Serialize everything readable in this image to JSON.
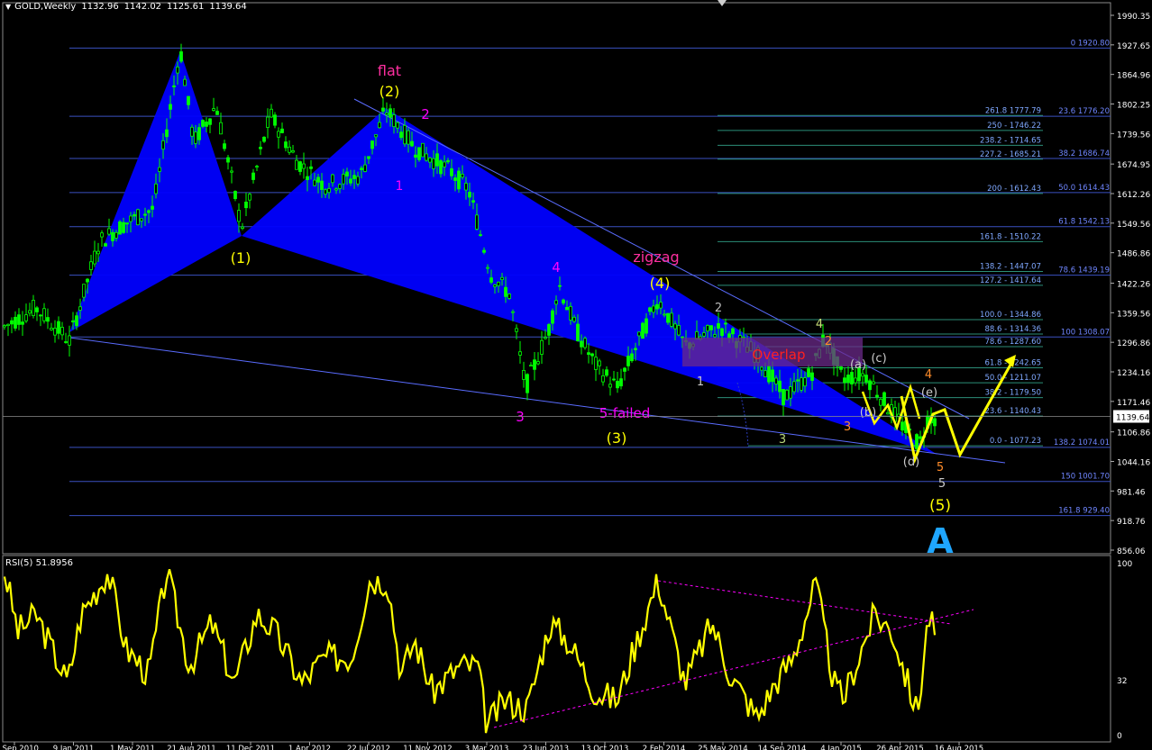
{
  "symbol": {
    "name": "GOLD,Weekly",
    "open": "1132.96",
    "high": "1142.02",
    "low": "1125.61",
    "close": "1139.64"
  },
  "price_axis": {
    "ticks": [
      "1990.35",
      "1927.65",
      "1864.96",
      "1802.25",
      "1739.56",
      "1674.95",
      "1612.26",
      "1549.56",
      "1486.86",
      "1422.26",
      "1359.56",
      "1296.86",
      "1234.16",
      "1171.46",
      "1106.86",
      "1044.16",
      "981.46",
      "918.76",
      "856.06"
    ],
    "current": "1139.64"
  },
  "rsi": {
    "label": "RSI(5) 51.8956",
    "ticks": [
      "100",
      "32",
      "0"
    ]
  },
  "date_axis": [
    "10 Sep 2010",
    "9 Jan 2011",
    "1 May 2011",
    "21 Aug 2011",
    "11 Dec 2011",
    "1 Apr 2012",
    "22 Jul 2012",
    "11 Nov 2012",
    "3 Mar 2013",
    "23 Jun 2013",
    "13 Oct 2013",
    "2 Feb 2014",
    "25 May 2014",
    "14 Sep 2014",
    "4 Jan 2015",
    "26 Apr 2015",
    "16 Aug 2015"
  ],
  "fib_right": [
    {
      "text": "0 1920.80",
      "price": 1920.8
    },
    {
      "text": "23.6 1776.20",
      "price": 1776.2
    },
    {
      "text": "38.2 1686.74",
      "price": 1686.74
    },
    {
      "text": "50.0 1614.43",
      "price": 1614.43
    },
    {
      "text": "61.8 1542.13",
      "price": 1542.13
    },
    {
      "text": "78.6 1439.19",
      "price": 1439.19
    },
    {
      "text": "100 1308.07",
      "price": 1308.07
    },
    {
      "text": "138.2 1074.01",
      "price": 1074.01
    },
    {
      "text": "150 1001.70",
      "price": 1001.7
    },
    {
      "text": "161.8 929.40",
      "price": 929.4
    }
  ],
  "fib_mid": [
    {
      "text": "261.8 1777.79",
      "price": 1777.79
    },
    {
      "text": "250 - 1746.22",
      "price": 1746.22
    },
    {
      "text": "238.2 - 1714.65",
      "price": 1714.65
    },
    {
      "text": "227.2 - 1685.21",
      "price": 1685.21
    },
    {
      "text": "200 - 1612.43",
      "price": 1612.43
    },
    {
      "text": "161.8 - 1510.22",
      "price": 1510.22
    },
    {
      "text": "138.2 - 1447.07",
      "price": 1447.07
    },
    {
      "text": "127.2 - 1417.64",
      "price": 1417.64
    },
    {
      "text": "100.0 - 1344.86",
      "price": 1344.86
    },
    {
      "text": "88.6 - 1314.36",
      "price": 1314.36
    },
    {
      "text": "78.6 - 1287.60",
      "price": 1287.6
    },
    {
      "text": "61.8 - 1242.65",
      "price": 1242.65
    },
    {
      "text": "50.0 - 1211.07",
      "price": 1211.07
    },
    {
      "text": "38.2 - 1179.50",
      "price": 1179.5
    },
    {
      "text": "23.6 - 1140.43",
      "price": 1140.43
    },
    {
      "text": "0.0 - 1077.23",
      "price": 1077.23
    }
  ],
  "annotations": {
    "flat": "flat",
    "w2": "(2)",
    "w1": "(1)",
    "m2": "2",
    "m1": "1",
    "zigzag": "zigzag",
    "w4": "(4)",
    "m4": "4",
    "m3": "3",
    "failed": "5-failed",
    "w3": "(3)",
    "g1": "1",
    "g2": "2",
    "g3": "3",
    "g4": "4",
    "overlap": "Overlap",
    "o2": "2",
    "o3": "3",
    "o4": "4",
    "o5": "5",
    "a": "(a)",
    "b": "(b)",
    "c": "(c)",
    "d": "(d)",
    "e": "(e)",
    "g5": "5",
    "w5": "(5)",
    "bigA": "A"
  },
  "colors": {
    "background": "#000000",
    "candle": "#00ff00",
    "triangle": "#0000ff",
    "fib_line": "#3a50c0",
    "fib_mid": "#2b8e78",
    "rsi": "#ffff00",
    "magenta": "#ff00ff",
    "yellow_label": "#ffff00",
    "overlap_box": "#6b2a8a",
    "overlap_text": "#ff2020",
    "bigA": "#1fa6ff"
  },
  "chart_data": {
    "type": "line",
    "title": "GOLD,Weekly",
    "series": [
      {
        "name": "GOLD",
        "values": [
          1250,
          1290,
          1330,
          1340,
          1390,
          1420,
          1500,
          1560,
          1620,
          1760,
          1900,
          1810,
          1700,
          1620,
          1790,
          1740,
          1560,
          1640,
          1700,
          1660,
          1620,
          1630,
          1600,
          1720,
          1790,
          1750,
          1700,
          1600,
          1560,
          1420,
          1320,
          1250,
          1380,
          1400,
          1280,
          1240,
          1300,
          1380,
          1320,
          1280,
          1320,
          1250,
          1200,
          1300,
          1260,
          1220,
          1180,
          1130,
          1090,
          1160
        ]
      }
    ],
    "ylim": [
      856.06,
      1990.35
    ],
    "rsi": {
      "name": "RSI(5)",
      "ylim": [
        0,
        100
      ],
      "last": 51.8956
    }
  }
}
